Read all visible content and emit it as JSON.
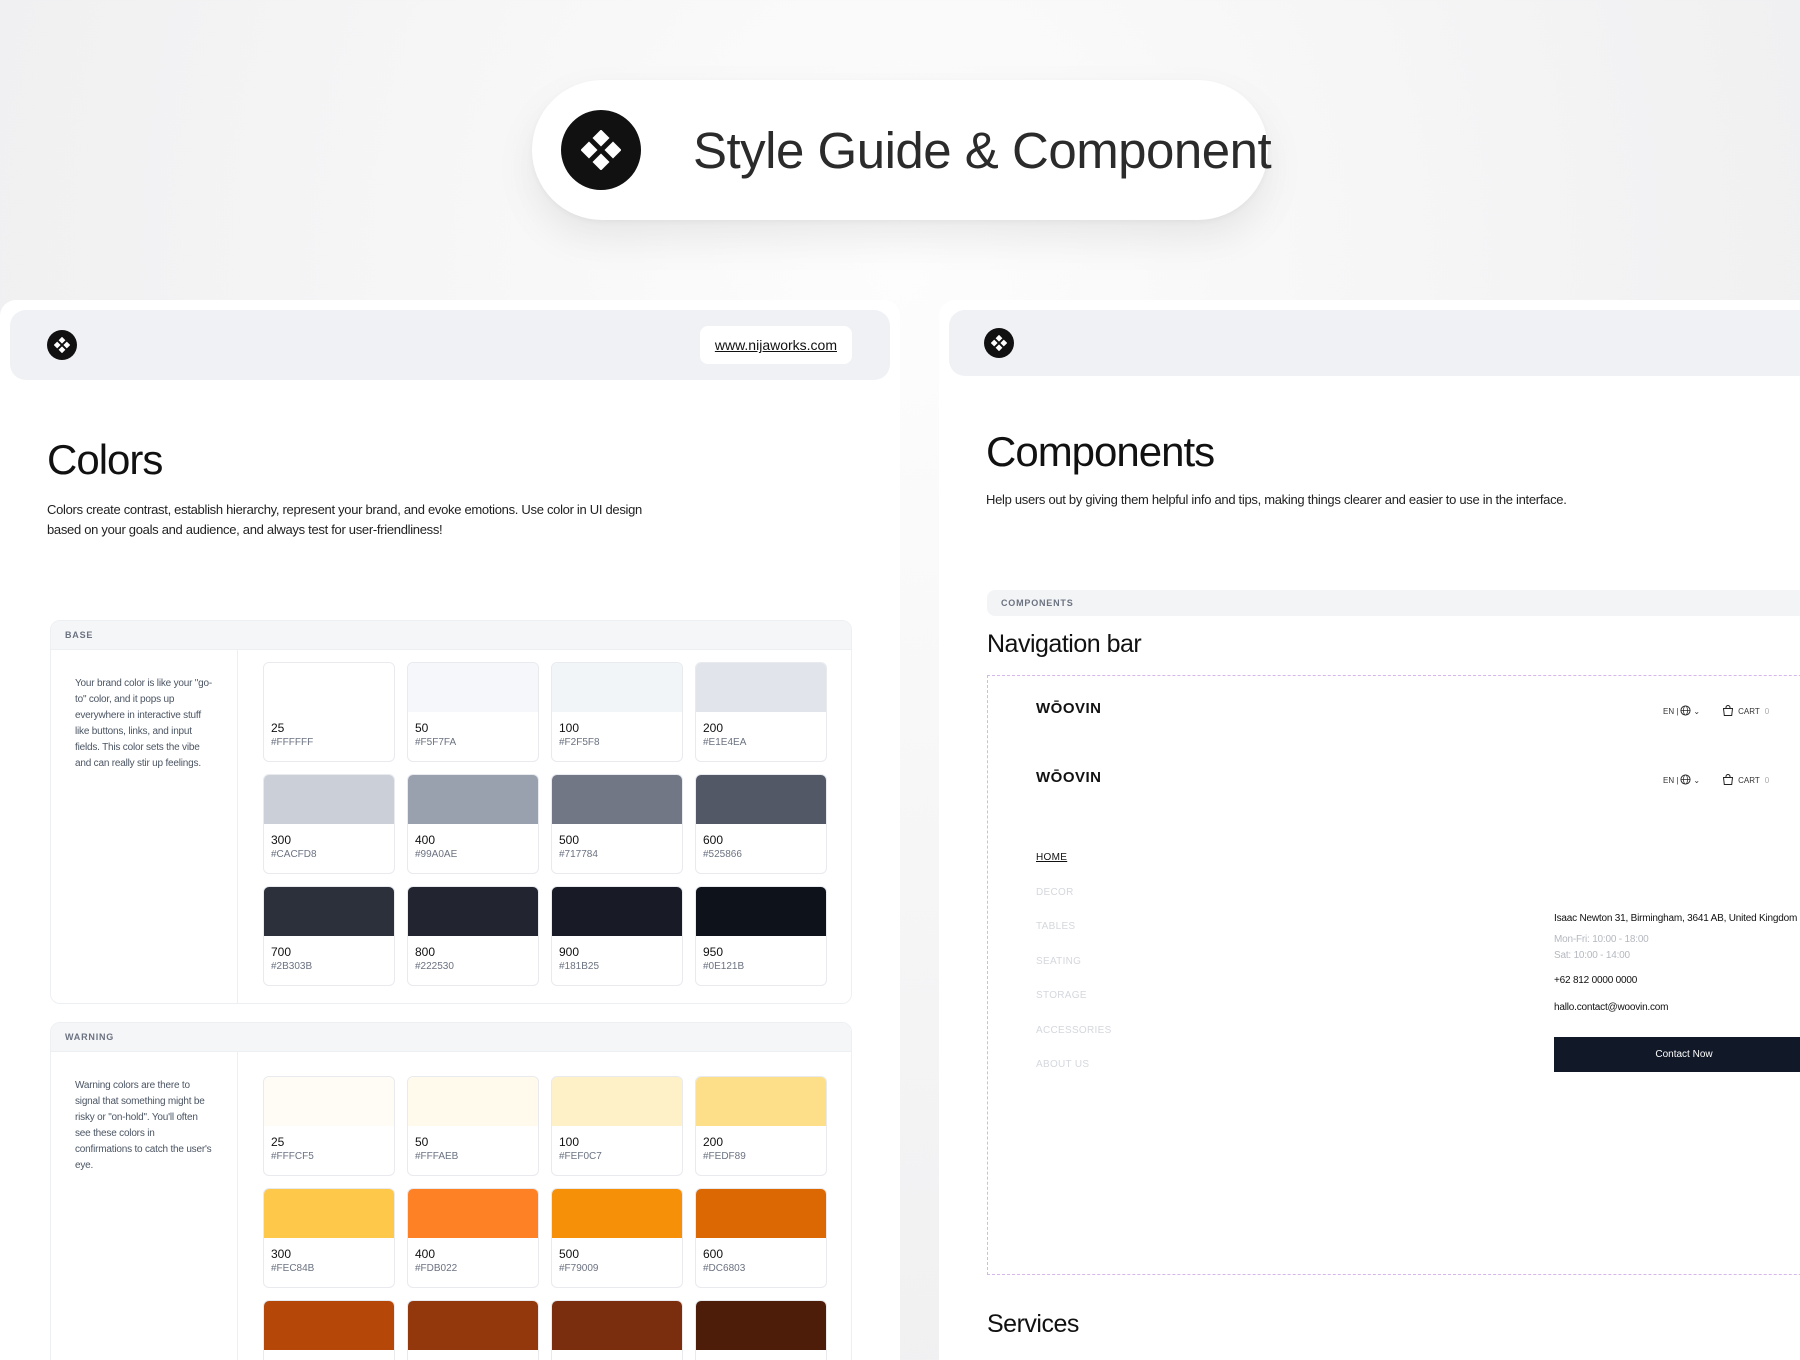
{
  "hero": {
    "title": "Style Guide & Component"
  },
  "colors_panel": {
    "url": "www.nijaworks.com",
    "title": "Colors",
    "description": "Colors create contrast, establish hierarchy, represent your brand, and evoke emotions. Use color in UI design based on your goals and audience, and always test for user-friendliness!",
    "base": {
      "heading": "BASE",
      "note": "Your brand color is like your \"go-to\" color, and it pops up everywhere in interactive stuff like buttons, links, and input fields. This color sets the vibe and can really stir up feelings.",
      "swatches": [
        {
          "shade": "25",
          "hex": "#FFFFFF"
        },
        {
          "shade": "50",
          "hex": "#F5F7FA"
        },
        {
          "shade": "100",
          "hex": "#F2F5F8"
        },
        {
          "shade": "200",
          "hex": "#E1E4EA"
        },
        {
          "shade": "300",
          "hex": "#CACFD8"
        },
        {
          "shade": "400",
          "hex": "#99A0AE"
        },
        {
          "shade": "500",
          "hex": "#717784"
        },
        {
          "shade": "600",
          "hex": "#525866"
        },
        {
          "shade": "700",
          "hex": "#2B303B"
        },
        {
          "shade": "800",
          "hex": "#222530"
        },
        {
          "shade": "900",
          "hex": "#181B25"
        },
        {
          "shade": "950",
          "hex": "#0E121B"
        }
      ]
    },
    "warning": {
      "heading": "WARNING",
      "note": "Warning colors are there to signal that something might be risky or \"on-hold\". You'll often see these colors in confirmations to catch the user's eye.",
      "swatches": [
        {
          "shade": "25",
          "hex": "#FFFCF5"
        },
        {
          "shade": "50",
          "hex": "#FFFAEB"
        },
        {
          "shade": "100",
          "hex": "#FEF0C7"
        },
        {
          "shade": "200",
          "hex": "#FEDF89"
        },
        {
          "shade": "300",
          "hex": "#FEC84B"
        },
        {
          "shade": "400",
          "hex": "#FDB022"
        },
        {
          "shade": "500",
          "hex": "#F79009"
        },
        {
          "shade": "600",
          "hex": "#DC6803"
        }
      ],
      "partial_row_colors": [
        "#B54708",
        "#93370D",
        "#7A2E0E",
        "#4E1D09"
      ]
    },
    "display_colors": {
      "warning_300": "#FEC84B",
      "warning_400": "#FF8126",
      "warning_500": "#F79009",
      "warning_600": "#DC6803"
    }
  },
  "components_panel": {
    "title": "Components",
    "description": "Help users out by giving them helpful info and tips, making things clearer and easier to use in the interface.",
    "section_label": "COMPONENTS",
    "nav_title": "Navigation bar",
    "brand": "WŌOVIN",
    "lang": "EN |",
    "cart": "CART",
    "cart_count": "0",
    "menu": [
      "HOME",
      "DECOR",
      "TABLES",
      "SEATING",
      "STORAGE",
      "ACCESSORIES",
      "ABOUT US"
    ],
    "address": "Isaac Newton 31, Birmingham, 3641 AB, United Kingdom",
    "hours_weekday": "Mon-Fri: 10:00 - 18:00",
    "hours_sat": "Sat: 10:00 - 14:00",
    "phone": "+62 812 0000 0000",
    "email": "hallo.contact@woovin.com",
    "cta": "Contact Now",
    "services_title": "Services"
  }
}
